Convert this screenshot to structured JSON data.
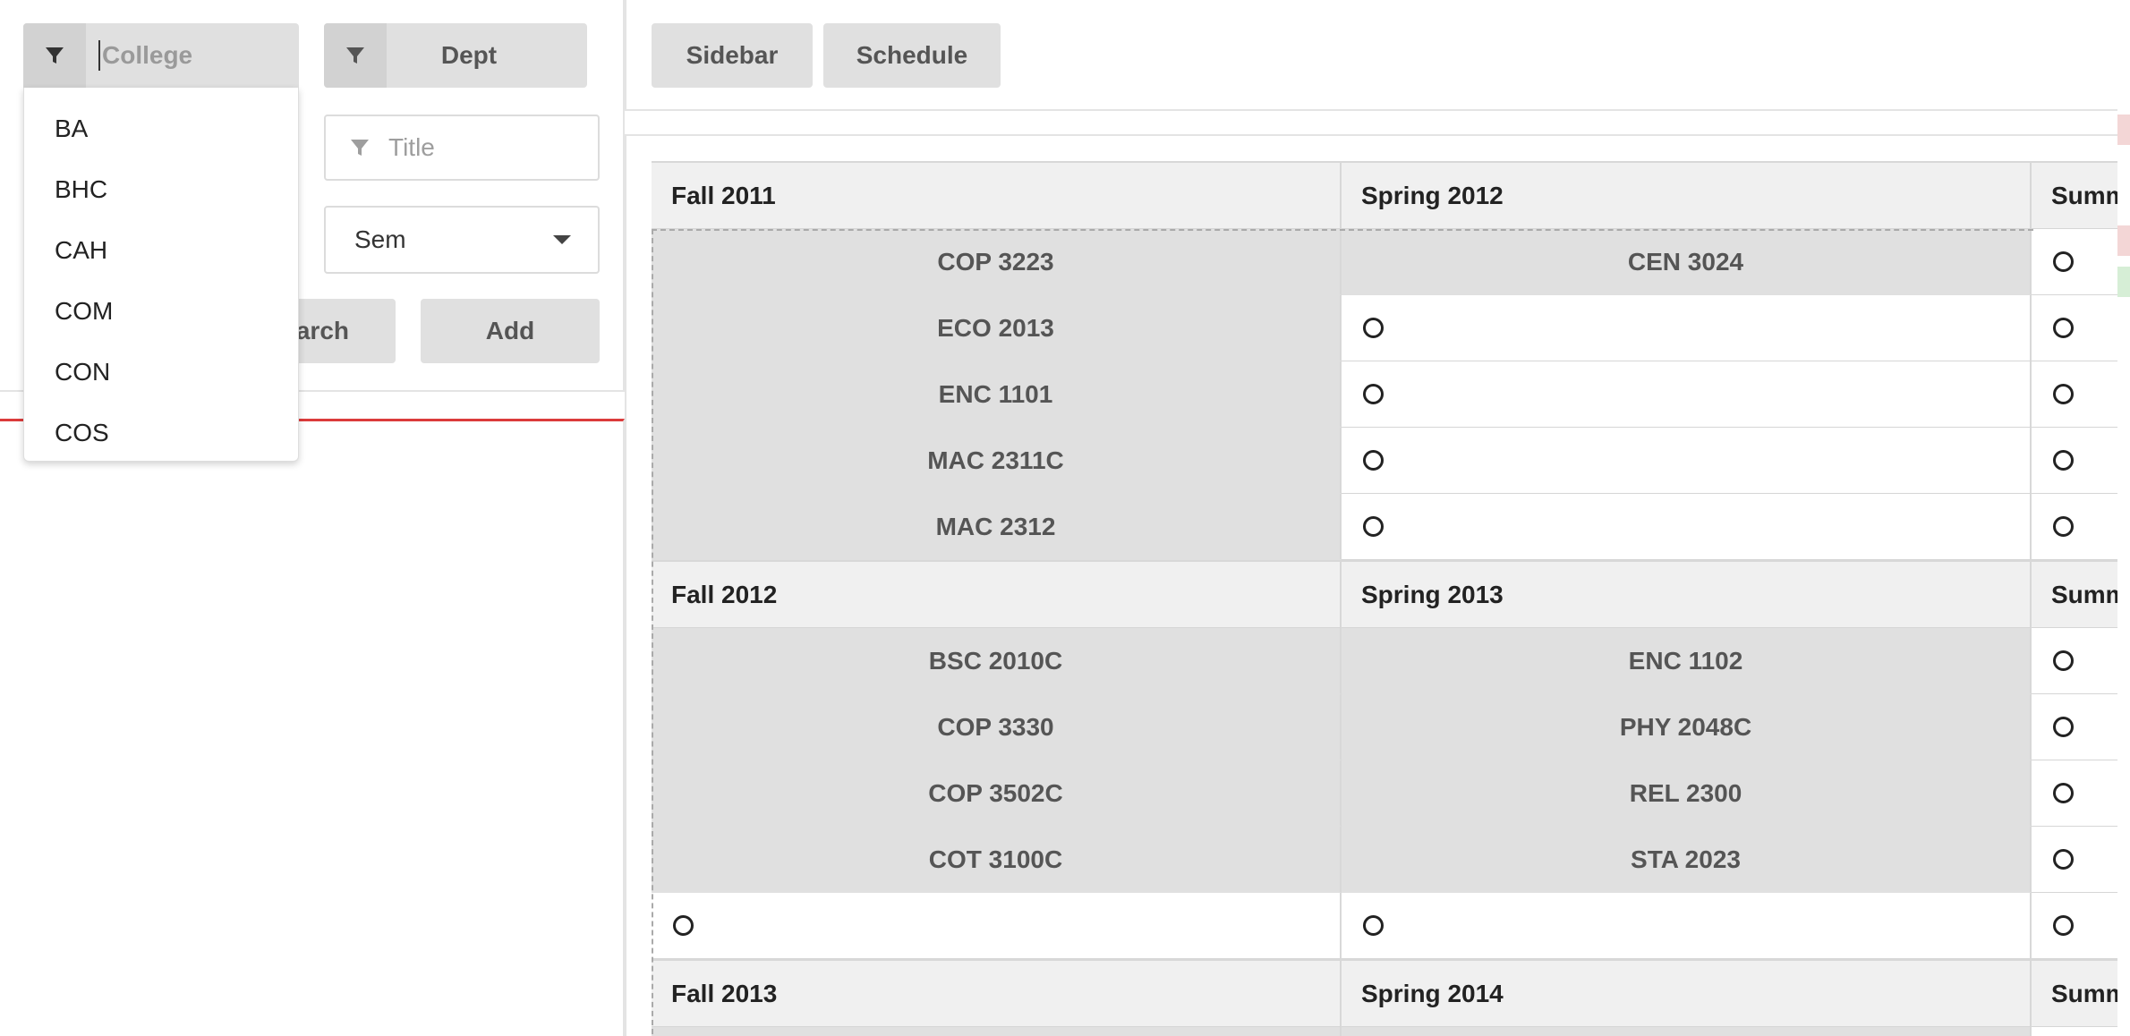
{
  "filters": {
    "college_placeholder": "College",
    "dept_label": "Dept",
    "title_placeholder": "Title",
    "sem_label": "Sem",
    "search_label": "arch",
    "add_label": "Add"
  },
  "college_dropdown": {
    "options": [
      "BA",
      "BHC",
      "CAH",
      "COM",
      "CON",
      "COS"
    ]
  },
  "toolbar": {
    "sidebar_label": "Sidebar",
    "schedule_label": "Schedule"
  },
  "schedule": {
    "years": [
      {
        "headers": [
          "Fall 2011",
          "Spring 2012",
          "Summ"
        ],
        "fall": [
          "COP 3223",
          "ECO 2013",
          "ENC 1101",
          "MAC 2311C",
          "MAC 2312"
        ],
        "spring": [
          "CEN 3024"
        ]
      },
      {
        "headers": [
          "Fall 2012",
          "Spring 2013",
          "Summ"
        ],
        "fall": [
          "BSC 2010C",
          "COP 3330",
          "COP 3502C",
          "COT 3100C"
        ],
        "spring": [
          "ENC 1102",
          "PHY 2048C",
          "REL 2300",
          "STA 2023"
        ]
      },
      {
        "headers": [
          "Fall 2013",
          "Spring 2014",
          "Summ"
        ]
      }
    ]
  },
  "colors": {
    "accent_red": "#db3b3b",
    "button_grey": "#e0e0e0",
    "course_cell": "#e0e0e0",
    "header_cell": "#f0f0f0"
  },
  "icons": {
    "filter": "filter-icon",
    "dropdown": "caret-down-icon",
    "empty_slot": "empty-slot-ring-icon"
  }
}
